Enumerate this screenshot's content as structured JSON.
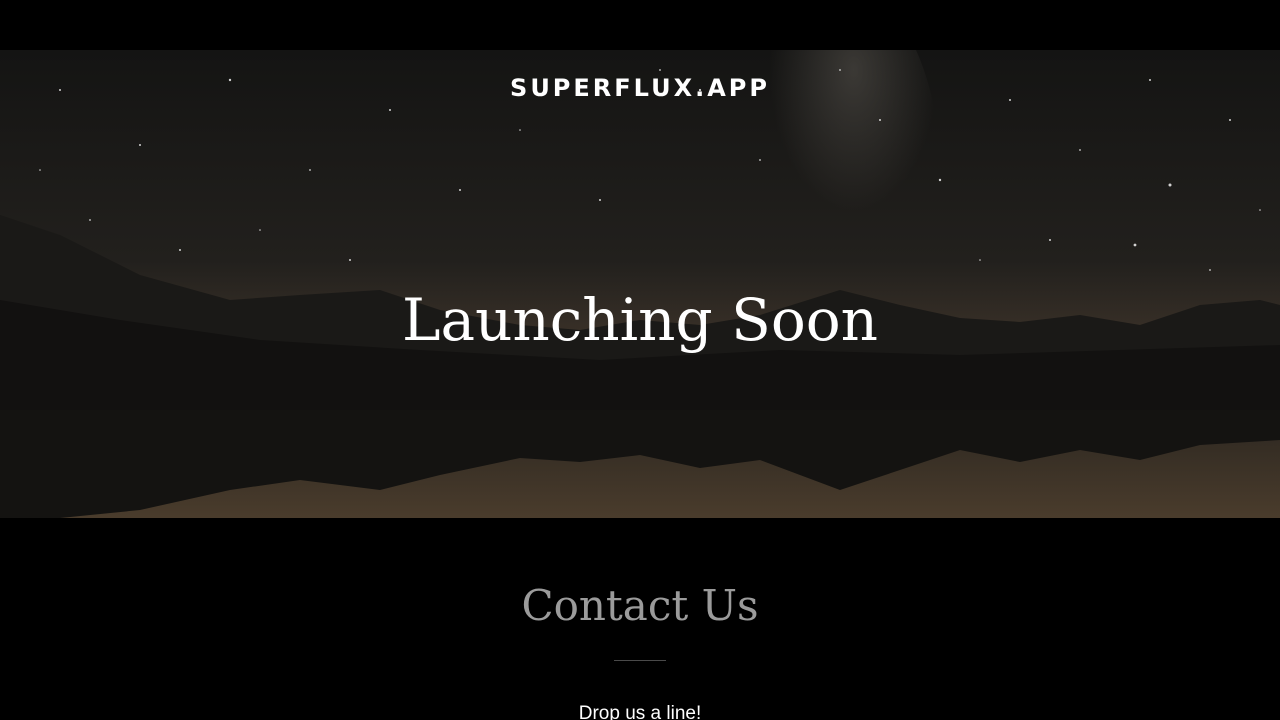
{
  "header": {
    "brand": "SUPERFLUX.APP"
  },
  "hero": {
    "headline": "Launching Soon"
  },
  "contact": {
    "title": "Contact Us",
    "subtitle": "Drop us a line!"
  },
  "colors": {
    "background": "#000000",
    "heading_text": "#ffffff",
    "contact_title": "#9b9b9b",
    "divider": "#4a4a4a"
  }
}
